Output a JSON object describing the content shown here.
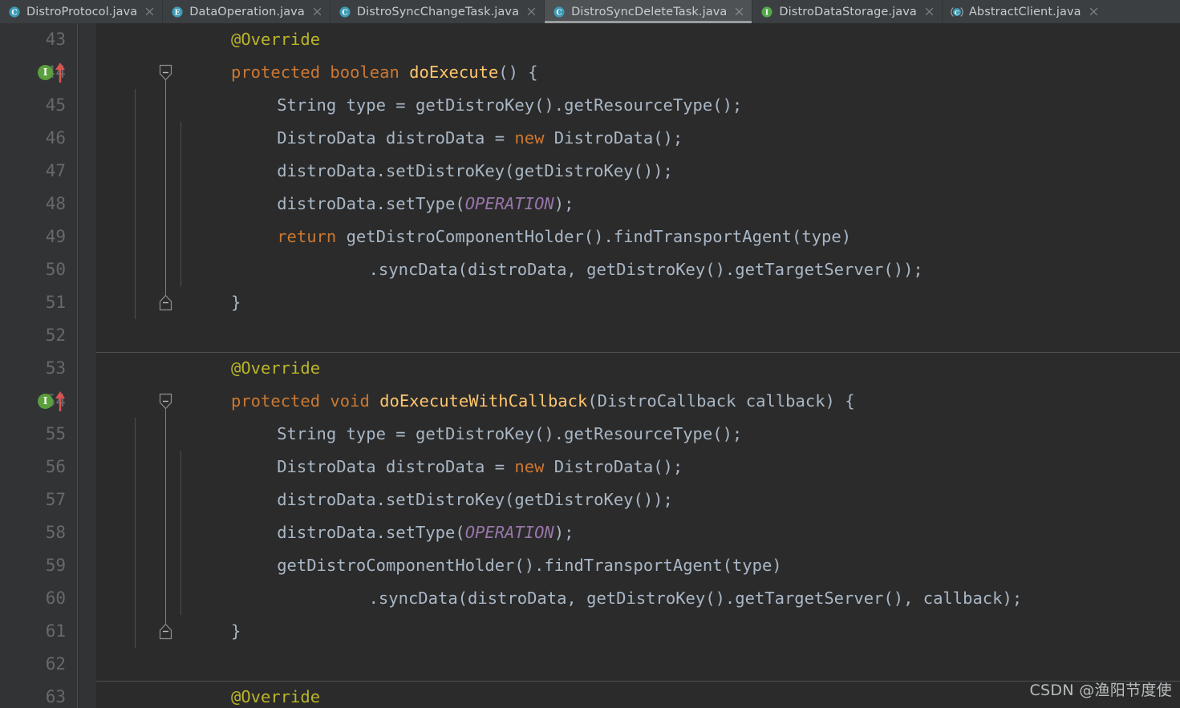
{
  "window": {
    "app": "IntelliJ IDEA Editor",
    "theme_background": "#2b2b2b",
    "gutter_background": "#313335",
    "tabbar_background": "#3c3f41",
    "active_tab_background": "#4e5254"
  },
  "tabs": [
    {
      "label": "DistroProtocol.java",
      "icon": "java-class-icon",
      "icon_letter": "C",
      "icon_color": "#3d9bb5",
      "active": false,
      "close_icon": "close-icon"
    },
    {
      "label": "DataOperation.java",
      "icon": "java-enum-icon",
      "icon_letter": "E",
      "icon_color": "#3d9bb5",
      "active": false,
      "close_icon": "close-icon"
    },
    {
      "label": "DistroSyncChangeTask.java",
      "icon": "java-class-icon",
      "icon_letter": "C",
      "icon_color": "#3d9bb5",
      "active": false,
      "close_icon": "close-icon"
    },
    {
      "label": "DistroSyncDeleteTask.java",
      "icon": "java-class-icon",
      "icon_letter": "C",
      "icon_color": "#3d9bb5",
      "active": true,
      "close_icon": "close-icon"
    },
    {
      "label": "DistroDataStorage.java",
      "icon": "java-interface-icon",
      "icon_letter": "I",
      "icon_color": "#56a64b",
      "active": false,
      "close_icon": "close-icon"
    },
    {
      "label": "AbstractClient.java",
      "icon": "java-abstract-class-icon",
      "icon_letter": "C",
      "icon_color": "#3d9bb5",
      "active": false,
      "close_icon": "close-icon"
    }
  ],
  "editor": {
    "first_visible_line": 43,
    "last_visible_line": 63,
    "line_height_px": 41,
    "syntax_colors": {
      "keyword": "#cc7832",
      "annotation": "#bbb529",
      "method": "#ffc66d",
      "identifier": "#a9b7c6",
      "static_field": "#9876aa",
      "line_number": "#666a6d"
    },
    "lines": [
      {
        "n": 43,
        "indent": 1,
        "tokens": [
          {
            "t": "@Override",
            "c": "anno"
          }
        ]
      },
      {
        "n": 44,
        "indent": 1,
        "marker": "override-implement-marker",
        "fold": "none",
        "tokens": [
          {
            "t": "protected ",
            "c": "kw"
          },
          {
            "t": "boolean ",
            "c": "kw"
          },
          {
            "t": "doExecute",
            "c": "mth"
          },
          {
            "t": "() {",
            "c": "pun"
          }
        ]
      },
      {
        "n": 45,
        "indent": 2,
        "tokens": [
          {
            "t": "String type = getDistroKey().getResourceType();",
            "c": "id"
          }
        ]
      },
      {
        "n": 46,
        "indent": 2,
        "tokens": [
          {
            "t": "DistroData distroData = ",
            "c": "id"
          },
          {
            "t": "new ",
            "c": "kw"
          },
          {
            "t": "DistroData();",
            "c": "id"
          }
        ]
      },
      {
        "n": 47,
        "indent": 2,
        "tokens": [
          {
            "t": "distroData.setDistroKey(getDistroKey());",
            "c": "id"
          }
        ]
      },
      {
        "n": 48,
        "indent": 2,
        "tokens": [
          {
            "t": "distroData.setType(",
            "c": "id"
          },
          {
            "t": "OPERATION",
            "c": "stat"
          },
          {
            "t": ");",
            "c": "id"
          }
        ]
      },
      {
        "n": 49,
        "indent": 2,
        "tokens": [
          {
            "t": "return ",
            "c": "kw"
          },
          {
            "t": "getDistroComponentHolder().findTransportAgent(type)",
            "c": "id"
          }
        ]
      },
      {
        "n": 50,
        "indent": 4,
        "tokens": [
          {
            "t": ".syncData(distroData, getDistroKey().getTargetServer());",
            "c": "id"
          }
        ]
      },
      {
        "n": 51,
        "indent": 1,
        "fold": "end",
        "tokens": [
          {
            "t": "}",
            "c": "id"
          }
        ]
      },
      {
        "n": 52,
        "indent": 0,
        "tokens": []
      },
      {
        "n": 53,
        "indent": 1,
        "separator_above": true,
        "tokens": [
          {
            "t": "@Override",
            "c": "anno"
          }
        ]
      },
      {
        "n": 54,
        "indent": 1,
        "marker": "override-implement-marker",
        "fold": "start",
        "tokens": [
          {
            "t": "protected ",
            "c": "kw"
          },
          {
            "t": "void ",
            "c": "kw"
          },
          {
            "t": "doExecuteWithCallback",
            "c": "mth"
          },
          {
            "t": "(DistroCallback callback) {",
            "c": "id"
          }
        ]
      },
      {
        "n": 55,
        "indent": 2,
        "tokens": [
          {
            "t": "String type = getDistroKey().getResourceType();",
            "c": "id"
          }
        ]
      },
      {
        "n": 56,
        "indent": 2,
        "tokens": [
          {
            "t": "DistroData distroData = ",
            "c": "id"
          },
          {
            "t": "new ",
            "c": "kw"
          },
          {
            "t": "DistroData();",
            "c": "id"
          }
        ]
      },
      {
        "n": 57,
        "indent": 2,
        "tokens": [
          {
            "t": "distroData.setDistroKey(getDistroKey());",
            "c": "id"
          }
        ]
      },
      {
        "n": 58,
        "indent": 2,
        "tokens": [
          {
            "t": "distroData.setType(",
            "c": "id"
          },
          {
            "t": "OPERATION",
            "c": "stat"
          },
          {
            "t": ");",
            "c": "id"
          }
        ]
      },
      {
        "n": 59,
        "indent": 2,
        "tokens": [
          {
            "t": "getDistroComponentHolder().findTransportAgent(type)",
            "c": "id"
          }
        ]
      },
      {
        "n": 60,
        "indent": 4,
        "tokens": [
          {
            "t": ".syncData(distroData, getDistroKey().getTargetServer(), callback);",
            "c": "id"
          }
        ]
      },
      {
        "n": 61,
        "indent": 1,
        "fold": "end",
        "tokens": [
          {
            "t": "}",
            "c": "id"
          }
        ]
      },
      {
        "n": 62,
        "indent": 0,
        "tokens": []
      },
      {
        "n": 63,
        "indent": 1,
        "separator_above": true,
        "tokens": [
          {
            "t": "@Override",
            "c": "anno"
          }
        ]
      }
    ]
  },
  "watermark": {
    "text": "CSDN @渔阳节度使"
  }
}
